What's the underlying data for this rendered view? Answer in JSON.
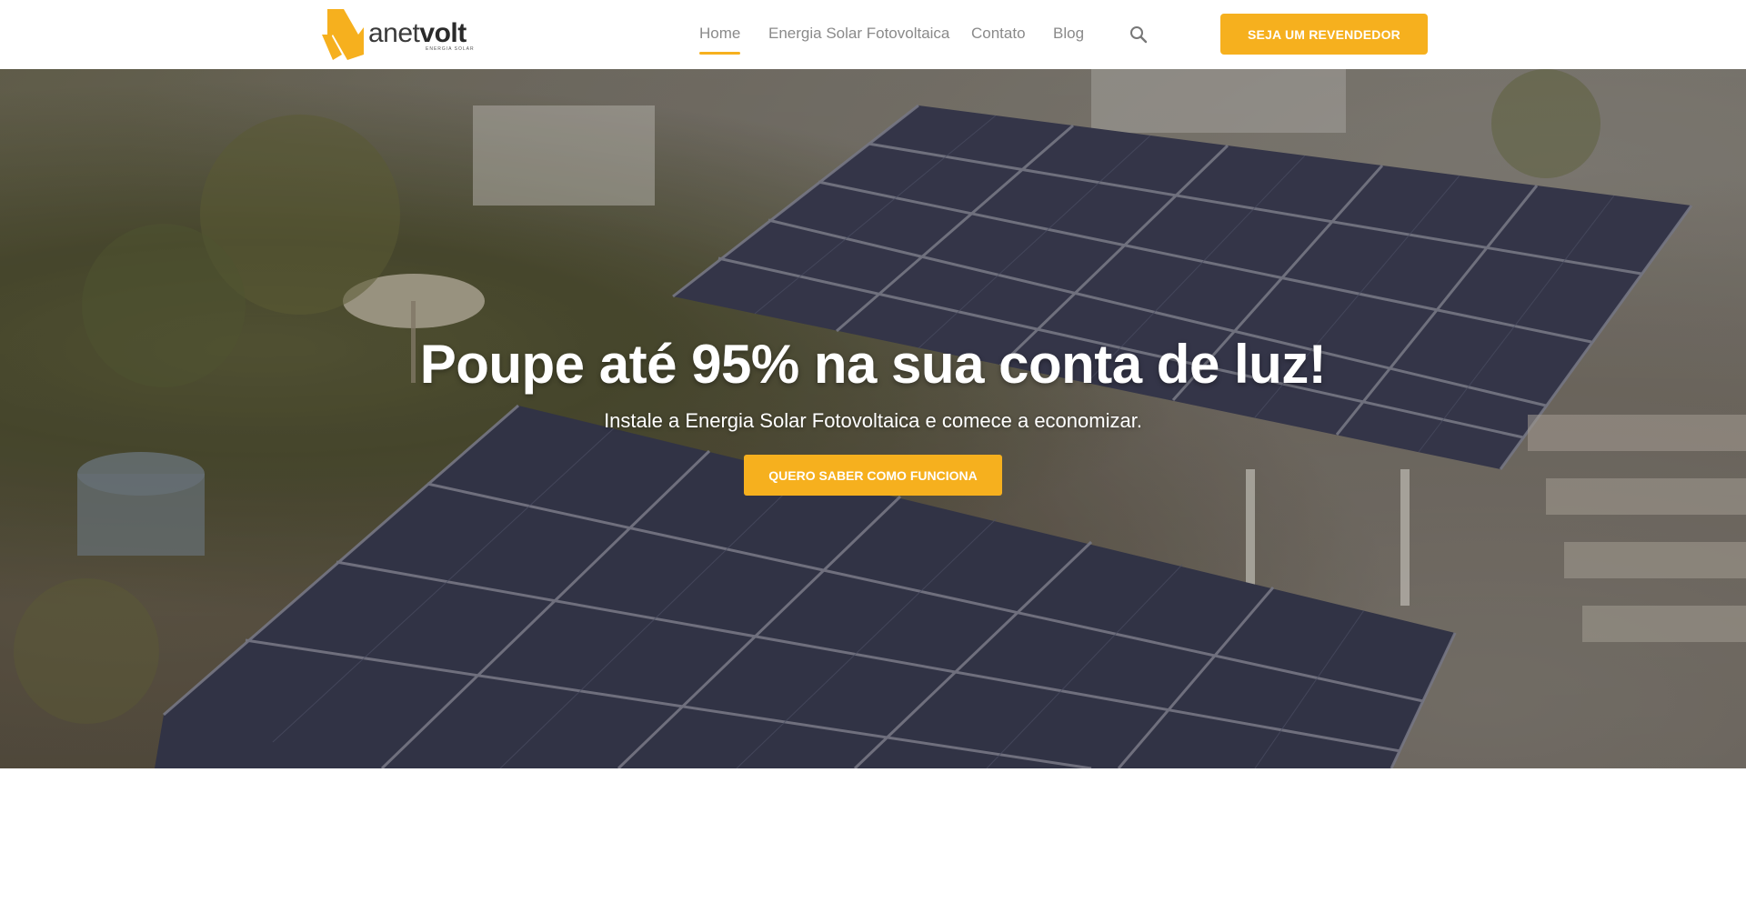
{
  "brand": {
    "name_light": "anet",
    "name_bold": "volt",
    "tagline": "ENERGIA SOLAR",
    "accent_color": "#f6b01e"
  },
  "nav": {
    "items": [
      {
        "label": "Home",
        "active": true
      },
      {
        "label": "Energia Solar Fotovoltaica",
        "active": false
      },
      {
        "label": "Contato",
        "active": false
      },
      {
        "label": "Blog",
        "active": false
      }
    ],
    "search_icon": "search-icon",
    "cta_label": "SEJA UM REVENDEDOR"
  },
  "hero": {
    "title": "Poupe até 95% na sua conta de luz!",
    "subtitle": "Instale a Energia Solar Fotovoltaica e comece a economizar.",
    "cta_label": "QUERO SABER COMO FUNCIONA"
  }
}
